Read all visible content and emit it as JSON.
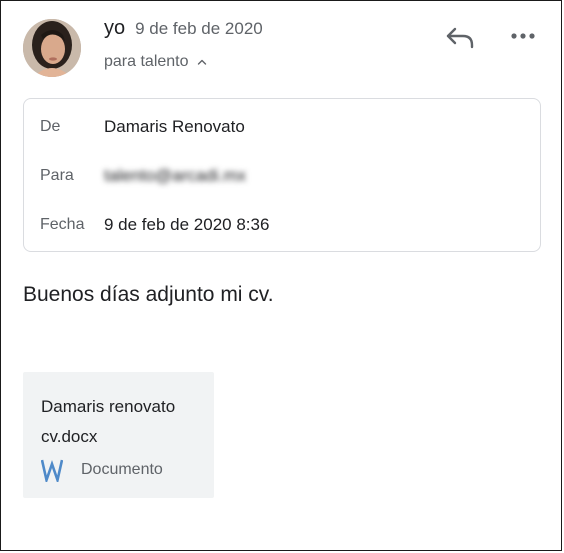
{
  "header": {
    "sender": "yo",
    "date": "9 de feb de 2020",
    "recipient_summary": "para talento",
    "avatar_icon": "profile-photo",
    "reply_icon": "reply-icon",
    "more_icon": "more-options-icon"
  },
  "details": {
    "from_label": "De",
    "from_value": "Damaris Renovato",
    "to_label": "Para",
    "to_value": "talento@arcadi.mx",
    "date_label": "Fecha",
    "date_value": "9 de feb de 2020 8:36"
  },
  "message": {
    "body": "Buenos días adjunto mi cv."
  },
  "attachment": {
    "name": "Damaris renovato cv.docx",
    "type_label": "Documento",
    "icon": "word-icon",
    "icon_color": "#2b579a"
  }
}
